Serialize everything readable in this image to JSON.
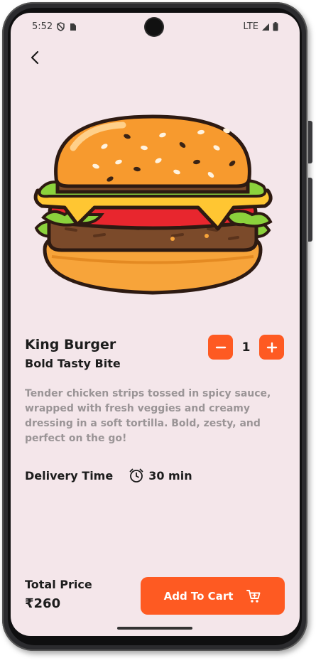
{
  "status_bar": {
    "time": "5:52",
    "network": "LTE"
  },
  "product": {
    "name": "King Burger",
    "tagline": "Bold Tasty Bite",
    "description": "Tender chicken strips tossed in spicy sauce, wrapped with fresh veggies and creamy dressing in a soft tortilla. Bold, zesty, and perfect on the go!",
    "quantity": "1"
  },
  "delivery": {
    "label": "Delivery Time",
    "value": "30 min"
  },
  "footer": {
    "total_label": "Total Price",
    "total_value": "₹260",
    "cart_button_label": "Add To Cart"
  },
  "colors": {
    "accent": "#fe5a22",
    "background": "#f4e6ea",
    "text": "#1c1c1c",
    "muted_text": "#9a9496"
  },
  "icons": [
    "back-arrow-icon",
    "minus-icon",
    "plus-icon",
    "alarm-clock-icon",
    "shopping-cart-icon"
  ]
}
